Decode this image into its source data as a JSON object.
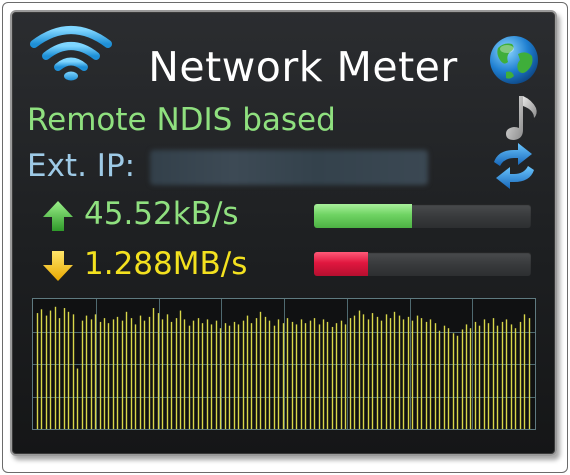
{
  "app": {
    "title": "Network Meter",
    "provider": "Remote NDIS based",
    "ext_ip_label": "Ext. IP:",
    "ext_ip_value": ""
  },
  "upload": {
    "value": "45.52kB/s",
    "level": 0.45,
    "color": "#6fd363"
  },
  "download": {
    "value": "1.288MB/s",
    "level": 0.25,
    "color": "#e0173f"
  },
  "icons": {
    "wifi": "wifi-icon",
    "globe": "globe-icon",
    "music": "music-note-icon",
    "refresh": "refresh-icon",
    "upload": "upload-arrow-icon",
    "download": "download-arrow-icon"
  },
  "graph": {
    "line_color": "#d8d64a",
    "grid_color": "#4f6a70",
    "values": [
      0.92,
      0.95,
      0.9,
      0.94,
      0.97,
      0.88,
      0.96,
      0.93,
      0.91,
      0.48,
      0.86,
      0.9,
      0.87,
      0.91,
      0.85,
      0.88,
      0.84,
      0.87,
      0.89,
      0.86,
      0.93,
      0.88,
      0.83,
      0.9,
      0.86,
      0.89,
      0.96,
      0.92,
      0.87,
      0.91,
      0.85,
      0.88,
      0.94,
      0.87,
      0.82,
      0.86,
      0.88,
      0.84,
      0.87,
      0.83,
      0.86,
      0.8,
      0.84,
      0.82,
      0.85,
      0.83,
      0.86,
      0.9,
      0.84,
      0.88,
      0.93,
      0.89,
      0.86,
      0.82,
      0.87,
      0.84,
      0.88,
      0.85,
      0.83,
      0.87,
      0.84,
      0.86,
      0.88,
      0.83,
      0.87,
      0.85,
      0.81,
      0.84,
      0.86,
      0.83,
      0.88,
      0.9,
      0.94,
      0.91,
      0.87,
      0.92,
      0.89,
      0.86,
      0.91,
      0.88,
      0.93,
      0.9,
      0.87,
      0.89,
      0.86,
      0.9,
      0.88,
      0.85,
      0.87,
      0.84,
      0.78,
      0.82,
      0.8,
      0.76,
      0.74,
      0.79,
      0.83,
      0.8,
      0.85,
      0.82,
      0.87,
      0.84,
      0.88,
      0.82,
      0.85,
      0.87,
      0.83,
      0.8,
      0.85,
      0.91,
      0.88
    ]
  }
}
